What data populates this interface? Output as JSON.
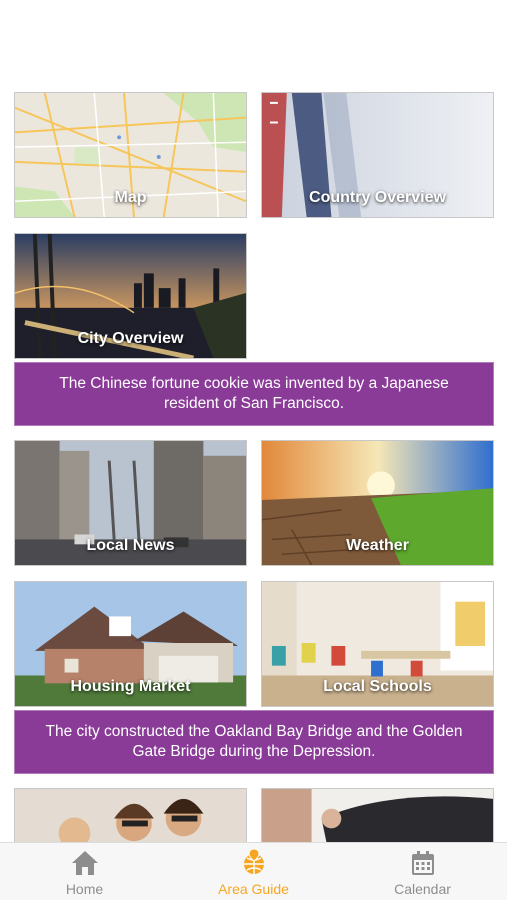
{
  "tiles": {
    "map": "Map",
    "country_overview": "Country Overview",
    "city_overview": "City Overview",
    "local_news": "Local News",
    "weather": "Weather",
    "housing_market": "Housing Market",
    "local_schools": "Local Schools"
  },
  "facts": [
    "The Chinese fortune cookie was invented by a Japanese resident of San Francisco.",
    "The city constructed the Oakland Bay Bridge and the Golden Gate Bridge during the Depression."
  ],
  "tabbar": {
    "home": "Home",
    "area_guide": "Area Guide",
    "calendar": "Calendar",
    "active": "Area Guide"
  },
  "colors": {
    "fact_background": "#8a3b98",
    "active_tab": "#f5a623",
    "inactive_tab": "#8d8d8d"
  }
}
